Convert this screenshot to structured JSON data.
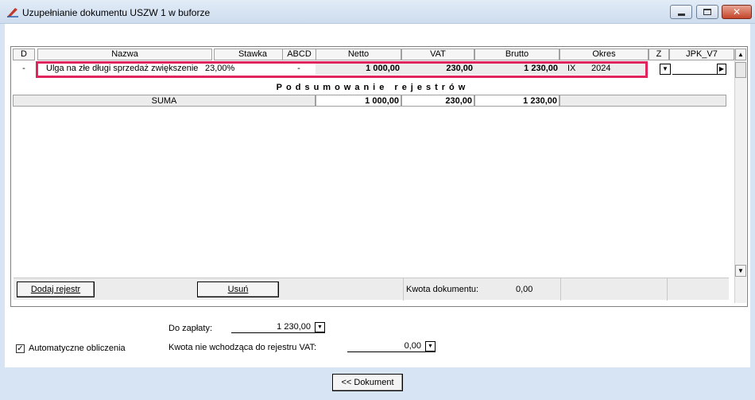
{
  "window": {
    "title": "Uzupełnianie dokumentu USZW 1 w buforze"
  },
  "grid": {
    "headers": [
      "D",
      "Nazwa",
      "Stawka",
      "ABCD",
      "Netto",
      "VAT",
      "Brutto",
      "Okres",
      "Z",
      "JPK_V7"
    ],
    "rows": [
      {
        "d": "-",
        "nazwa": "Ulga na złe długi sprzedaż zwiększenie",
        "stawka": "23,00%",
        "abcd": "-",
        "netto": "1 000,00",
        "vat": "230,00",
        "brutto": "1 230,00",
        "okres_month": "IX",
        "okres_year": "2024"
      }
    ],
    "summary_title": "Podsumowanie rejestrów",
    "summary": {
      "label": "SUMA",
      "netto": "1 000,00",
      "vat": "230,00",
      "brutto": "1 230,00"
    },
    "highlight_color": "#e0245e"
  },
  "bottom": {
    "add_label": "Dodaj rejestr",
    "remove_label": "Usuń",
    "doc_amount_label": "Kwota dokumentu:",
    "doc_amount_value": "0,00"
  },
  "form": {
    "do_zaplaty_label": "Do zapłaty:",
    "do_zaplaty_value": "1 230,00",
    "auto_label": "Automatyczne obliczenia",
    "auto_checked": true,
    "kwota_label": "Kwota nie wchodząca do rejestru VAT:",
    "kwota_value": "0,00"
  },
  "footer": {
    "dokument_label": "<< Dokument"
  }
}
